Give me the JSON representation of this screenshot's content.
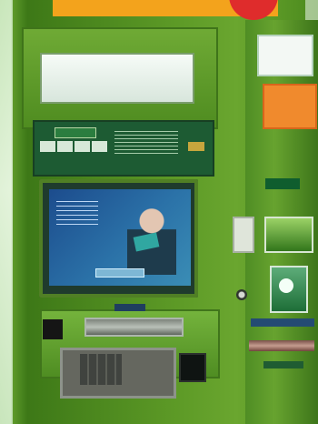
{
  "scene": {
    "subject": "atm machine",
    "main_color": "#5e9b27",
    "accent_color": "#f3a31c",
    "screen_color": "#2b72a8"
  },
  "icons": [
    "bank-logo-icon",
    "card-network-icons",
    "camera-icon",
    "contactless-icon"
  ]
}
